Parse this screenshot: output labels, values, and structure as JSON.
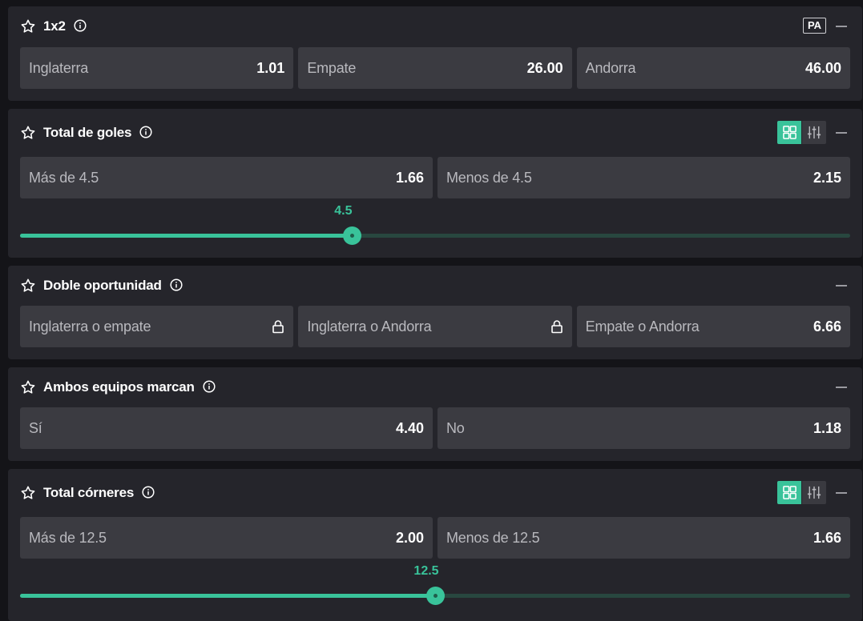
{
  "markets": [
    {
      "title": "1x2",
      "badge": "PA",
      "odds": [
        {
          "label": "Inglaterra",
          "value": "1.01"
        },
        {
          "label": "Empate",
          "value": "26.00"
        },
        {
          "label": "Andorra",
          "value": "46.00"
        }
      ]
    },
    {
      "title": "Total de goles",
      "odds": [
        {
          "label": "Más de 4.5",
          "value": "1.66"
        },
        {
          "label": "Menos de 4.5",
          "value": "2.15"
        }
      ],
      "slider": {
        "value": "4.5",
        "fraction": 0.4
      }
    },
    {
      "title": "Doble oportunidad",
      "odds": [
        {
          "label": "Inglaterra o empate",
          "value": "",
          "locked": true
        },
        {
          "label": "Inglaterra o Andorra",
          "value": "",
          "locked": true
        },
        {
          "label": "Empate o Andorra",
          "value": "6.66"
        }
      ]
    },
    {
      "title": "Ambos equipos marcan",
      "odds": [
        {
          "label": "Sí",
          "value": "4.40"
        },
        {
          "label": "No",
          "value": "1.18"
        }
      ]
    },
    {
      "title": "Total córneres",
      "odds": [
        {
          "label": "Más de 12.5",
          "value": "2.00"
        },
        {
          "label": "Menos de 12.5",
          "value": "1.66"
        }
      ],
      "slider": {
        "value": "12.5",
        "fraction": 0.5
      }
    }
  ],
  "colors": {
    "accent": "#39c39a",
    "panel": "#25252b",
    "button": "#3b3b41",
    "background": "#141418"
  },
  "icons": {
    "favorite": "star-outline-icon",
    "info": "info-circle-icon",
    "collapse": "minus-icon",
    "lock": "lock-icon",
    "grid_view": "grid-icon",
    "slider_view": "sliders-icon"
  }
}
